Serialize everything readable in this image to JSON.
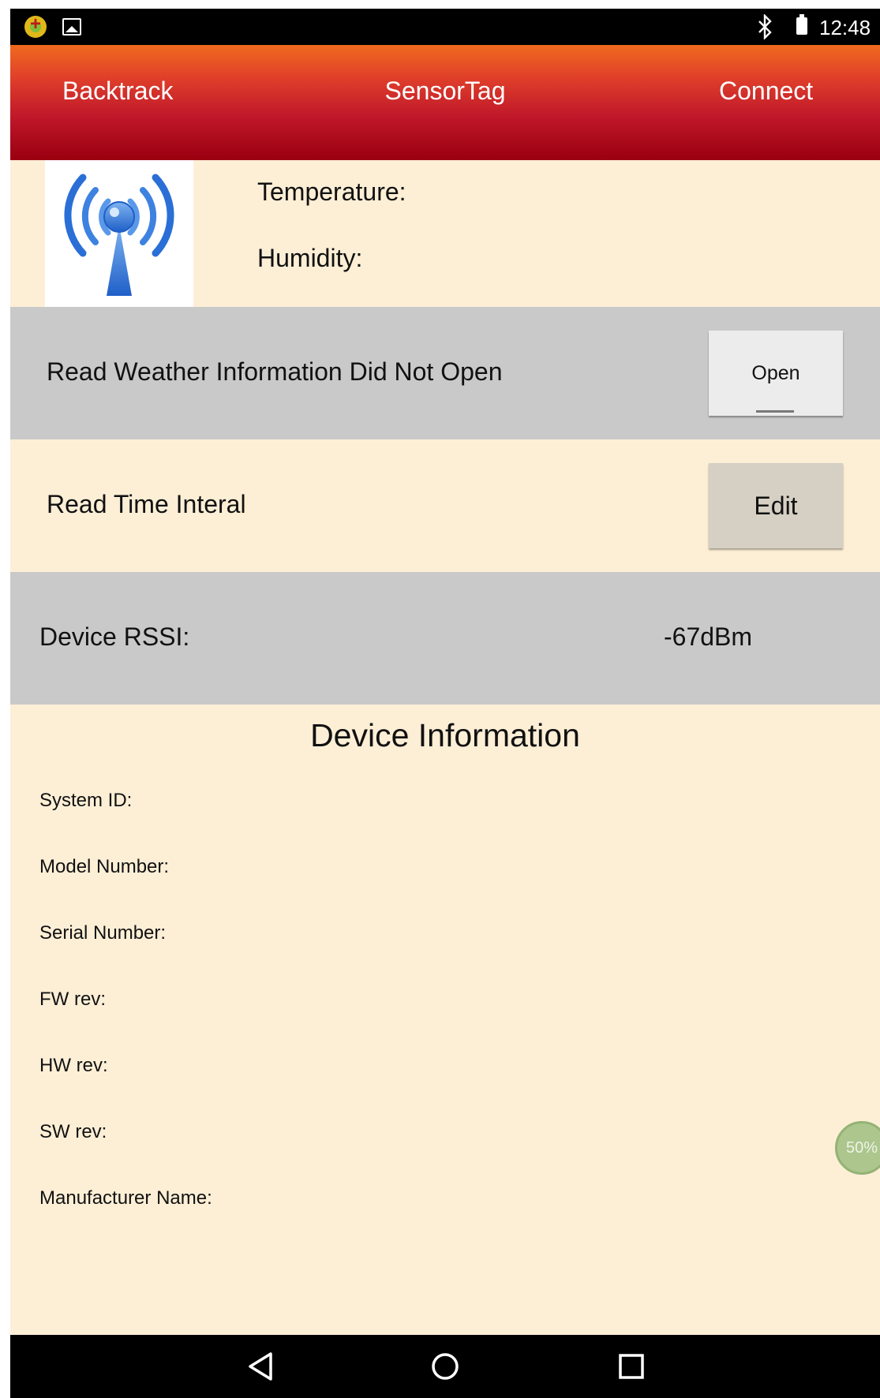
{
  "status_bar": {
    "time": "12:48",
    "icons": [
      "app-notification-icon",
      "image-notification-icon",
      "bluetooth-icon",
      "battery-icon"
    ]
  },
  "header": {
    "back_label": "Backtrack",
    "title": "SensorTag",
    "connect_label": "Connect",
    "gradient_colors": [
      "#f06a1e",
      "#c0182a",
      "#9a0010"
    ]
  },
  "sensor": {
    "icon": "antenna-signal-icon",
    "temperature_label": "Temperature:",
    "humidity_label": "Humidity:"
  },
  "weather_row": {
    "label": "Read Weather Information Did Not Open",
    "button_label": "Open"
  },
  "interval_row": {
    "label": "Read Time Interal",
    "button_label": "Edit"
  },
  "rssi_row": {
    "label": "Device RSSI:",
    "value": "-67dBm"
  },
  "device_info": {
    "title": "Device Information",
    "items": [
      {
        "label": "System ID:"
      },
      {
        "label": "Model Number:"
      },
      {
        "label": "Serial Number:"
      },
      {
        "label": "FW rev:"
      },
      {
        "label": "HW rev:"
      },
      {
        "label": "SW rev:"
      },
      {
        "label": "Manufacturer Name:"
      }
    ]
  },
  "overlay_badge": {
    "text": "50%"
  },
  "nav_bar": {
    "buttons": [
      "back-triangle-icon",
      "home-circle-icon",
      "recents-square-icon"
    ]
  },
  "colors": {
    "background": "#fdefd6",
    "grey_row": "#c9c9c9",
    "edit_button": "#d5cfc4",
    "open_button": "#ececec"
  }
}
